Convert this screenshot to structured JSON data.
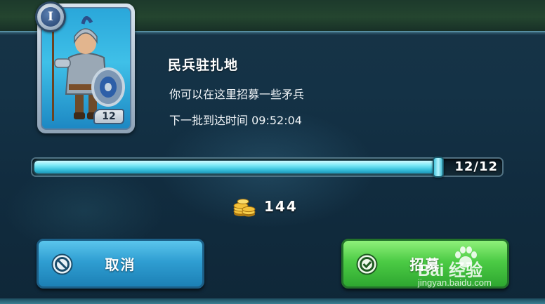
{
  "unit_card": {
    "level_roman": "I",
    "troop_count": "12",
    "art_icon": "spearman-soldier-icon"
  },
  "building": {
    "title": "民兵驻扎地",
    "description": "你可以在这里招募一些矛兵",
    "next_batch": "下一批到达时间 09:52:04"
  },
  "recruit_slider": {
    "count_label": "12/12",
    "current": 12,
    "max": 12,
    "fill_fraction": 1.0
  },
  "cost": {
    "icon": "gold-coins-icon",
    "value": "144"
  },
  "buttons": {
    "cancel_label": "取消",
    "cancel_icon": "cancel-circle-icon",
    "recruit_label": "招募",
    "recruit_icon": "confirm-check-icon"
  },
  "watermark": {
    "main": "Bai 经验",
    "sub": "jingyan.baidu.com"
  },
  "colors": {
    "cancel_button": "#2f9ed2",
    "recruit_button": "#4ccb45",
    "slider_fill": "#7eeaf7",
    "background": "#143246"
  }
}
